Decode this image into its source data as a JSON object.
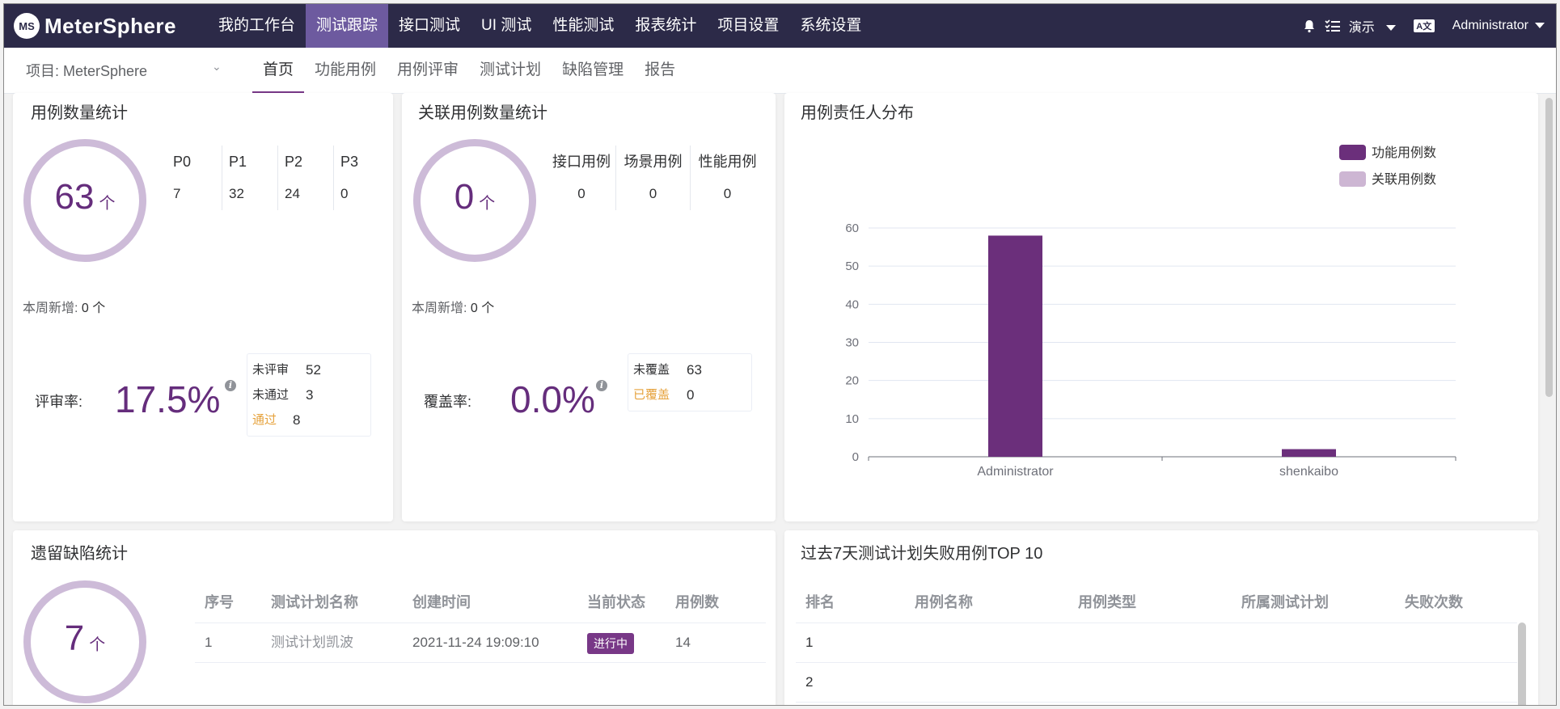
{
  "app": {
    "name": "MeterSphere",
    "logo_mark": "MS"
  },
  "nav": {
    "items": [
      "我的工作台",
      "测试跟踪",
      "接口测试",
      "UI 测试",
      "性能测试",
      "报表统计",
      "项目设置",
      "系统设置"
    ],
    "active_index": 1
  },
  "topright": {
    "workspace": "演示",
    "user": "Administrator",
    "lang_icon": "A文"
  },
  "subbar": {
    "project": "项目: MeterSphere",
    "tabs": [
      "首页",
      "功能用例",
      "用例评审",
      "测试计划",
      "缺陷管理",
      "报告"
    ],
    "active_index": 0
  },
  "case_stats": {
    "title": "用例数量统计",
    "total": "63",
    "unit": "个",
    "priorities": [
      {
        "label": "P0",
        "value": "7"
      },
      {
        "label": "P1",
        "value": "32"
      },
      {
        "label": "P2",
        "value": "24"
      },
      {
        "label": "P3",
        "value": "0"
      }
    ],
    "weekly_label": "本周新增:",
    "weekly_value": "0 个",
    "rate_label": "评审率:",
    "rate_value": "17.5%",
    "legend": [
      {
        "label": "未评审",
        "value": "52"
      },
      {
        "label": "未通过",
        "value": "3"
      },
      {
        "label": "通过",
        "value": "8"
      }
    ]
  },
  "related_stats": {
    "title": "关联用例数量统计",
    "total": "0",
    "unit": "个",
    "types": [
      {
        "label": "接口用例",
        "value": "0"
      },
      {
        "label": "场景用例",
        "value": "0"
      },
      {
        "label": "性能用例",
        "value": "0"
      }
    ],
    "weekly_label": "本周新增:",
    "weekly_value": "0 个",
    "rate_label": "覆盖率:",
    "rate_value": "0.0%",
    "legend": [
      {
        "label": "未覆盖",
        "value": "63"
      },
      {
        "label": "已覆盖",
        "value": "0"
      }
    ]
  },
  "owner_dist": {
    "title": "用例责任人分布"
  },
  "chart_data": {
    "type": "bar",
    "categories": [
      "Administrator",
      "shenkaibo"
    ],
    "series": [
      {
        "name": "功能用例数",
        "values": [
          58,
          2
        ],
        "color": "#6b2f7b"
      },
      {
        "name": "关联用例数",
        "values": [
          0,
          0
        ],
        "color": "#cdb6d3"
      }
    ],
    "ylim": [
      0,
      60
    ],
    "yticks": [
      0,
      10,
      20,
      30,
      40,
      50,
      60
    ],
    "legend_position": "top-right",
    "grid": true
  },
  "defects": {
    "title": "遗留缺陷统计",
    "total": "7",
    "unit": "个",
    "columns": [
      "序号",
      "测试计划名称",
      "创建时间",
      "当前状态",
      "用例数"
    ],
    "rows": [
      {
        "index": "1",
        "name": "测试计划凯波",
        "created": "2021-11-24 19:09:10",
        "status": "进行中",
        "count": "14"
      }
    ]
  },
  "top10": {
    "title": "过去7天测试计划失败用例TOP 10",
    "columns": [
      "排名",
      "用例名称",
      "用例类型",
      "所属测试计划",
      "失败次数"
    ],
    "rows": [
      {
        "rank": "1"
      },
      {
        "rank": "2"
      }
    ]
  }
}
